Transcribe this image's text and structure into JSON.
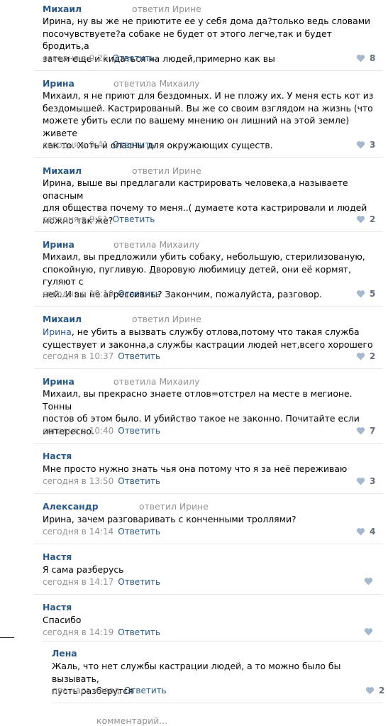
{
  "comments": [
    {
      "author": "Михаил",
      "reply_to": "ответил Ирине",
      "lines": [
        "Ирина, ну вы же не приютите ее у себя дома да?только ведь словами",
        "посочувствуете?а собаке не будет от этого легче,так и будет бродить,а",
        "затем еще и кидаться на людей,примерно как вы"
      ],
      "time": "сегодня в 9:25",
      "answer": "Ответить",
      "likes": "8"
    },
    {
      "author": "Ирина",
      "reply_to": "ответила Михаилу",
      "lines": [
        "Михаил, я не приют для бездомных. И не пложу их. У меня есть кот из",
        "бездомышей. Кастрированый. Вы же со своим взглядом на жизнь (что",
        "можете убить если по вашему мнению он лишний на этой земле) живете",
        "как то. Хоть и опасны для окружающих существ."
      ],
      "time": "сегодня в 9:41",
      "answer": "Ответить",
      "likes": "3"
    },
    {
      "author": "Михаил",
      "reply_to": "ответил Ирине",
      "lines": [
        "Ирина, выше вы предлагали кастрировать человека,а называете опасным",
        "для общества почему то меня..( думаете кота кастрировали и людей",
        "можно так же?"
      ],
      "time": "сегодня в 9:51",
      "answer": "Ответить",
      "likes": "2"
    },
    {
      "author": "Ирина",
      "reply_to": "ответила Михаилу",
      "lines": [
        "Михаил, вы предложили убить собаку, небольшую, стерилизованую,",
        "спокойную, пугливую. Дворовую любимицу детей, они её кормят, гуляют с",
        "ней. И вы не агрессивны? Закончим, пожалуйста, разговор."
      ],
      "time": "сегодня в 10:19",
      "answer": "Ответить",
      "likes": "5"
    },
    {
      "author": "Михаил",
      "reply_to": "ответил Ирине",
      "mention": "Ирина",
      "lines": [
        ", не убить а вызвать службу отлова,потому что такая служба",
        "существует и законна,а службы кастрации людей нет,всего хорошего"
      ],
      "time": "сегодня в 10:37",
      "answer": "Ответить",
      "likes": "2"
    },
    {
      "author": "Ирина",
      "reply_to": "ответила Михаилу",
      "lines": [
        "Михаил, вы прекрасно знаете отлов=отстрел на месте в мегионе. Тонны",
        "постов об этом было. И убийство такое не законно. Почитайте если",
        "интересно."
      ],
      "time": "сегодня в 10:40",
      "answer": "Ответить",
      "likes": "7"
    },
    {
      "author": "Настя",
      "reply_to": "",
      "lines": [
        "Мне просто нужно знать чья она потому что я за неё переживаю"
      ],
      "time": "сегодня в 13:50",
      "answer": "Ответить",
      "likes": "3"
    },
    {
      "author": "Александр",
      "reply_to": "ответил Ирине",
      "lines": [
        "Ирина, зачем разговаривать с конченными троллями?"
      ],
      "time": "сегодня в 14:14",
      "answer": "Ответить",
      "likes": "4"
    },
    {
      "author": "Настя",
      "reply_to": "",
      "lines": [
        "Я сама разберусь"
      ],
      "time": "сегодня в 14:17",
      "answer": "Ответить",
      "likes": ""
    },
    {
      "author": "Настя",
      "reply_to": "",
      "lines": [
        "Спасибо"
      ],
      "time": "сегодня в 14:19",
      "answer": "Ответить",
      "likes": ""
    },
    {
      "author": "Лена",
      "reply_to": "",
      "lines": [
        "Жаль, что нет службы кастрации людей, а то можно было бы вызывать,",
        "пусть разберутся"
      ],
      "time": "два часа назад",
      "answer": "Ответить",
      "likes": "2"
    }
  ],
  "comment_input": {
    "placeholder": "комментарий..."
  }
}
